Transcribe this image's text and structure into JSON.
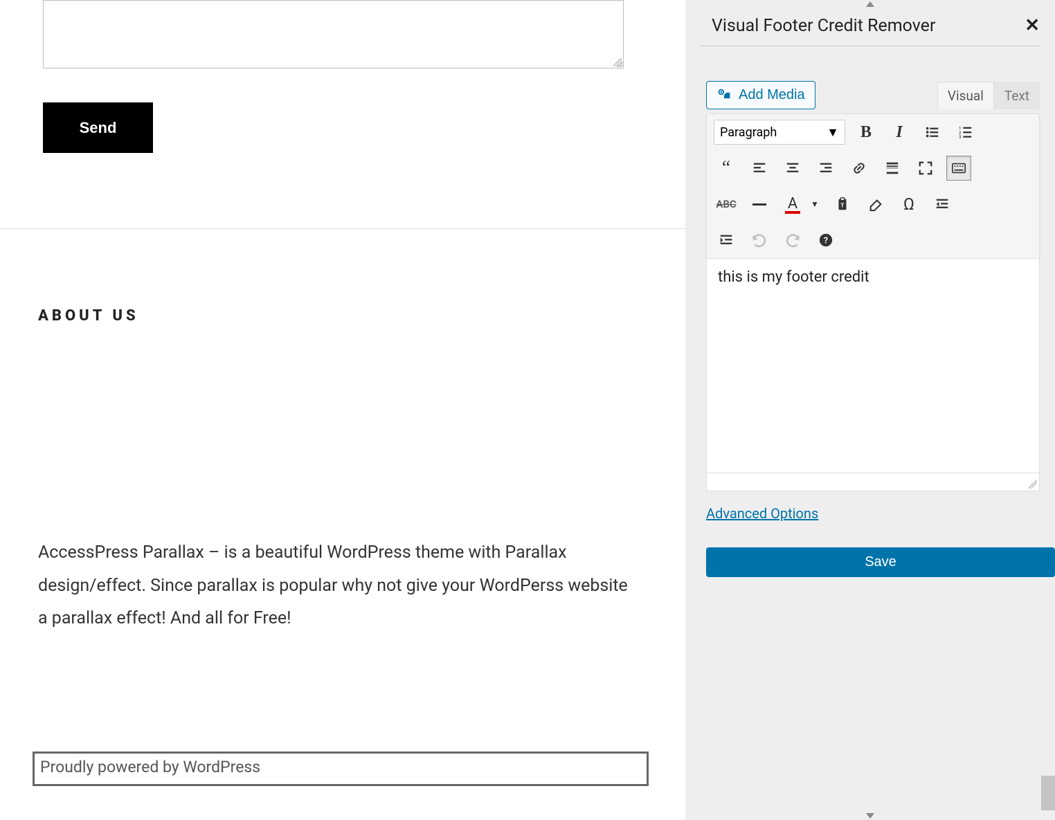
{
  "left": {
    "send_label": "Send",
    "about_heading": "ABOUT US",
    "about_text": "AccessPress Parallax – is a beautiful WordPress theme with Parallax design/effect. Since parallax is popular why not give your WordPerss website a parallax effect! And all for Free!",
    "footer_credit": "Proudly powered by WordPress"
  },
  "panel": {
    "title": "Visual Footer Credit Remover",
    "add_media": "Add Media",
    "tabs": {
      "visual": "Visual",
      "text": "Text"
    },
    "format_selected": "Paragraph",
    "editor_content": "this is my footer credit",
    "advanced_link": "Advanced Options",
    "save_label": "Save",
    "icons": {
      "bold": "bold",
      "italic": "italic",
      "ul": "bulleted-list",
      "ol": "numbered-list",
      "quote": "blockquote",
      "alignl": "align-left",
      "alignc": "align-center",
      "alignr": "align-right",
      "link": "insert-link",
      "more": "read-more",
      "fullscreen": "fullscreen",
      "keyboard": "toggle-toolbar",
      "strike": "strikethrough",
      "hr": "horizontal-rule",
      "tcolor": "text-color",
      "paste": "paste-as-text",
      "clear": "clear-formatting",
      "omega": "special-character",
      "outdent": "outdent",
      "indent": "indent",
      "undo": "undo",
      "redo": "redo",
      "help": "help"
    }
  }
}
